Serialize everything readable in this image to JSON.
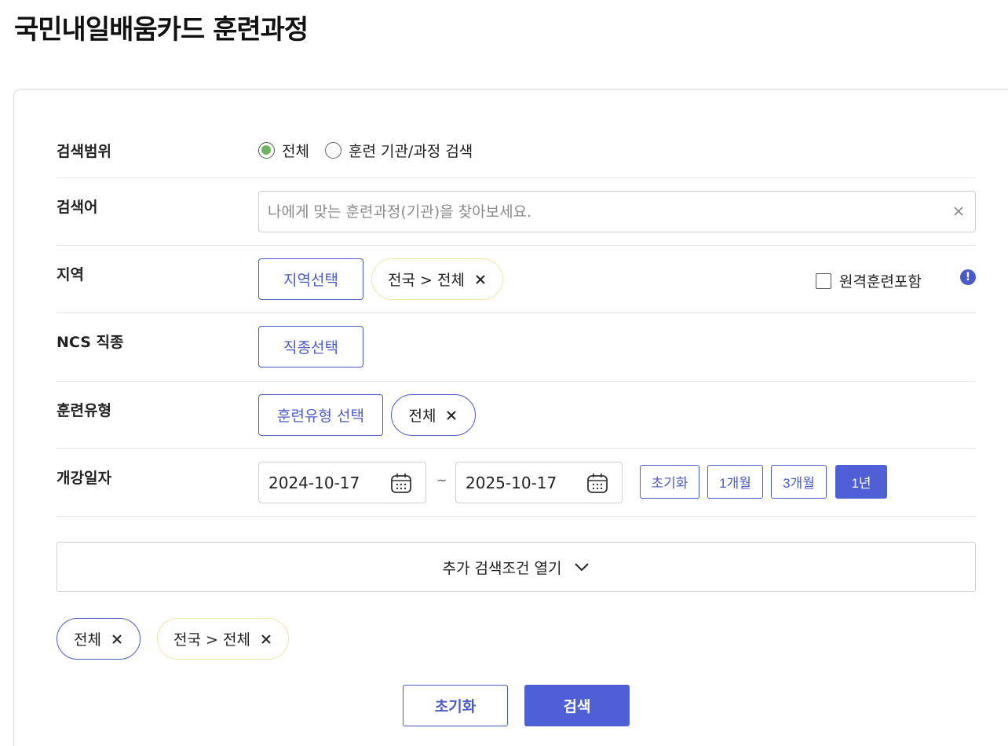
{
  "page": {
    "title": "국민내일배움카드 훈련과정"
  },
  "colors": {
    "accent": "#4f5fd6",
    "radio_checked": "#6db55c",
    "chip_yellow_border": "#f0e6a8"
  },
  "search_scope": {
    "label": "검색범위",
    "options": [
      {
        "label": "전체",
        "checked": true
      },
      {
        "label": "훈련 기관/과정 검색",
        "checked": false
      }
    ]
  },
  "keyword": {
    "label": "검색어",
    "placeholder": "나에게 맞는 훈련과정(기관)을 찾아보세요.",
    "value": ""
  },
  "region": {
    "label": "지역",
    "select_button": "지역선택",
    "chip": "전국 > 전체",
    "remote_label": "원격훈련포함",
    "remote_checked": false,
    "info_icon": "!"
  },
  "ncs": {
    "label": "NCS 직종",
    "select_button": "직종선택"
  },
  "training_type": {
    "label": "훈련유형",
    "select_button": "훈련유형 선택",
    "chip": "전체"
  },
  "open_date": {
    "label": "개강일자",
    "start": "2024-10-17",
    "separator": "~",
    "end": "2025-10-17",
    "buttons": [
      "초기화",
      "1개월",
      "3개월",
      "1년"
    ],
    "active": "1년"
  },
  "more": {
    "label": "추가 검색조건 열기"
  },
  "selected_chips": [
    "전체",
    "전국 > 전체"
  ],
  "actions": {
    "reset": "초기화",
    "search": "검색"
  }
}
